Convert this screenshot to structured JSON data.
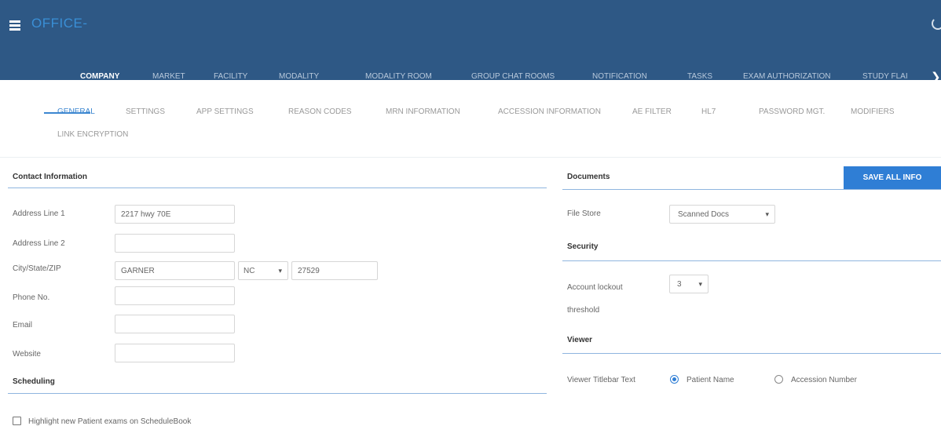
{
  "header": {
    "menu_icon": "hamburger-icon",
    "app_title": "OFFICE-",
    "power_icon": "power-icon",
    "next_icon": "chevron-right-icon"
  },
  "main_nav": {
    "tabs": [
      {
        "label": "COMPANY",
        "active": true
      },
      {
        "label": "MARKET"
      },
      {
        "label": "FACILITY"
      },
      {
        "label": "MODALITY"
      },
      {
        "label": "MODALITY ROOM"
      },
      {
        "label": "GROUP CHAT ROOMS"
      },
      {
        "label": "NOTIFICATION"
      },
      {
        "label": "TASKS"
      },
      {
        "label": "EXAM AUTHORIZATION"
      },
      {
        "label": "STUDY FLAI"
      }
    ]
  },
  "sub_nav": {
    "tabs": [
      {
        "label": "GENERAL",
        "active": true
      },
      {
        "label": "SETTINGS"
      },
      {
        "label": "APP SETTINGS"
      },
      {
        "label": "REASON CODES"
      },
      {
        "label": "MRN INFORMATION"
      },
      {
        "label": "ACCESSION INFORMATION"
      },
      {
        "label": "AE FILTER"
      },
      {
        "label": "HL7"
      },
      {
        "label": "PASSWORD MGT."
      },
      {
        "label": "MODIFIERS"
      },
      {
        "label": "LINK ENCRYPTION"
      }
    ]
  },
  "contact": {
    "title": "Contact Information",
    "address1_label": "Address Line 1",
    "address1_value": "2217 hwy 70E",
    "address2_label": "Address Line 2",
    "address2_value": "",
    "city_label": "City/State/ZIP",
    "city_value": "GARNER",
    "state_value": "NC",
    "zip_value": "27529",
    "phone_label": "Phone No.",
    "phone_value": "",
    "email_label": "Email",
    "email_value": "",
    "website_label": "Website",
    "website_value": ""
  },
  "scheduling": {
    "title": "Scheduling",
    "highlight_label": "Highlight new Patient exams on ScheduleBook",
    "highlight_checked": false
  },
  "documents": {
    "title": "Documents",
    "save_label": "SAVE ALL INFO",
    "file_store_label": "File Store",
    "file_store_value": "Scanned Docs"
  },
  "security": {
    "title": "Security",
    "lockout_label_1": "Account lockout",
    "lockout_label_2": "threshold",
    "lockout_value": "3"
  },
  "viewer": {
    "title": "Viewer",
    "titlebar_label": "Viewer Titlebar Text",
    "option_patient": "Patient Name",
    "option_accession": "Accession Number",
    "selected": "Patient Name"
  },
  "colors": {
    "header_bg": "#2e5885",
    "accent": "#2f7ed5",
    "section_line": "#8fb5df"
  }
}
